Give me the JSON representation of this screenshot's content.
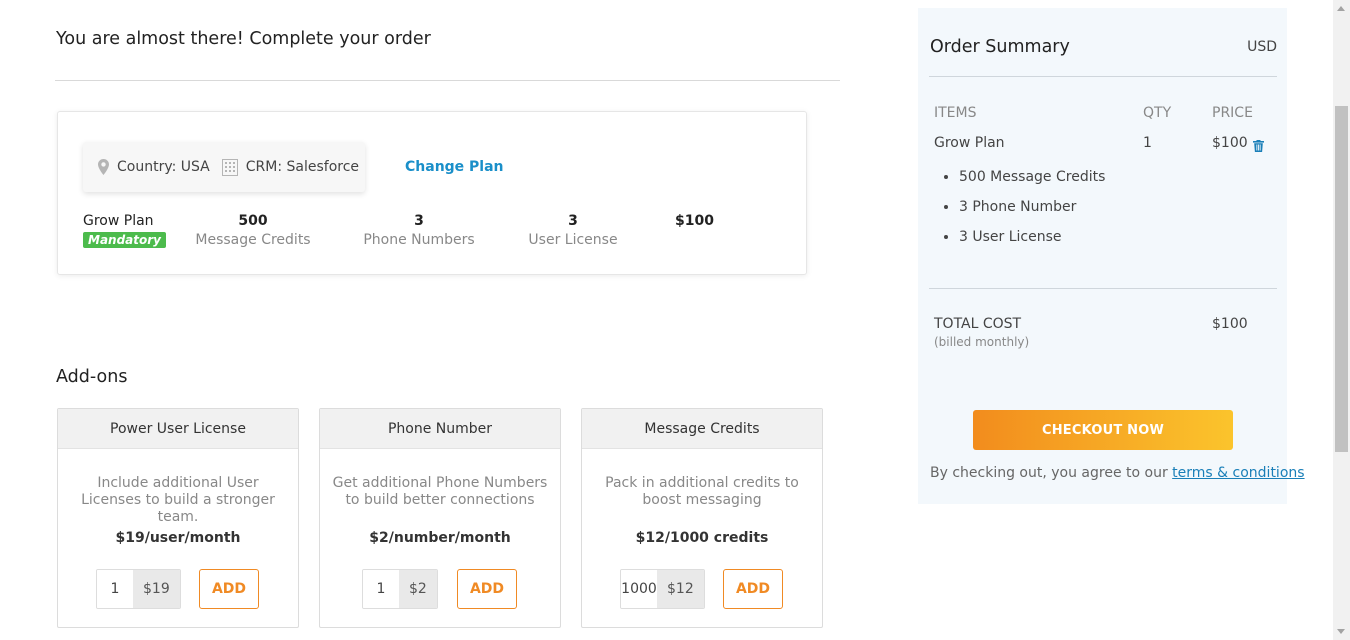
{
  "page": {
    "title": "You are almost there! Complete your order"
  },
  "plan": {
    "country": "Country: USA",
    "crm": "CRM: Salesforce",
    "change_plan": "Change Plan",
    "name": "Grow Plan",
    "badge": "Mandatory",
    "stats": [
      {
        "value": "500",
        "label": "Message Credits"
      },
      {
        "value": "3",
        "label": "Phone Numbers"
      },
      {
        "value": "3",
        "label": "User License"
      }
    ],
    "price": "$100"
  },
  "addons": {
    "title": "Add-ons",
    "items": [
      {
        "name": "Power User License",
        "desc": "Include additional User Licenses to build a stronger team.",
        "price": "$19/user/month",
        "qty": "1",
        "total": "$19",
        "add": "ADD"
      },
      {
        "name": "Phone Number",
        "desc": "Get additional Phone Numbers to build better connections",
        "price": "$2/number/month",
        "qty": "1",
        "total": "$2",
        "add": "ADD"
      },
      {
        "name": "Message Credits",
        "desc": "Pack in additional credits to boost messaging",
        "price": "$12/1000 credits",
        "qty": "1000",
        "total": "$12",
        "add": "ADD"
      }
    ]
  },
  "summary": {
    "title": "Order Summary",
    "currency": "USD",
    "col_items": "ITEMS",
    "col_qty": "QTY",
    "col_price": "PRICE",
    "item_name": "Grow Plan",
    "item_qty": "1",
    "item_price": "$100",
    "includes": [
      "500 Message Credits",
      "3 Phone Number",
      "3 User License"
    ],
    "total_label": "TOTAL COST",
    "total_sub": "(billed monthly)",
    "total_value": "$100",
    "checkout": "CHECKOUT NOW",
    "agree_text": "By checking out, you agree to our ",
    "terms": "terms & conditions"
  },
  "colors": {
    "accent_blue": "#1a8fc9",
    "accent_orange": "#f08a24",
    "badge_green": "#4cbb4c"
  }
}
